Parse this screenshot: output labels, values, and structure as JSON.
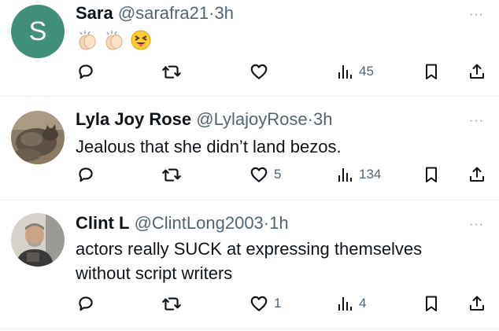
{
  "tweets": [
    {
      "avatar_letter": "S",
      "avatar_color": "#3f8f7a",
      "name": "Sara",
      "handle": "@sarafra21",
      "time": "3h",
      "text": "",
      "emoji": [
        "clapping-hands",
        "clapping-hands",
        "squinting-face-with-tongue"
      ],
      "likes": "",
      "views": "45"
    },
    {
      "name": "Lyla Joy Rose",
      "handle": "@LylajoyRose",
      "time": "3h",
      "text": "Jealous that she didn’t land bezos.",
      "likes": "5",
      "views": "134"
    },
    {
      "name": "Clint L",
      "handle": "@ClintLong2003",
      "time": "1h",
      "text": "actors really SUCK at expressing themselves without script writers",
      "likes": "1",
      "views": "4"
    }
  ],
  "separator": "·",
  "more_glyph": "···",
  "colors": {
    "text": "#0f1419",
    "secondary": "#536471",
    "divider": "#eff3f4"
  }
}
